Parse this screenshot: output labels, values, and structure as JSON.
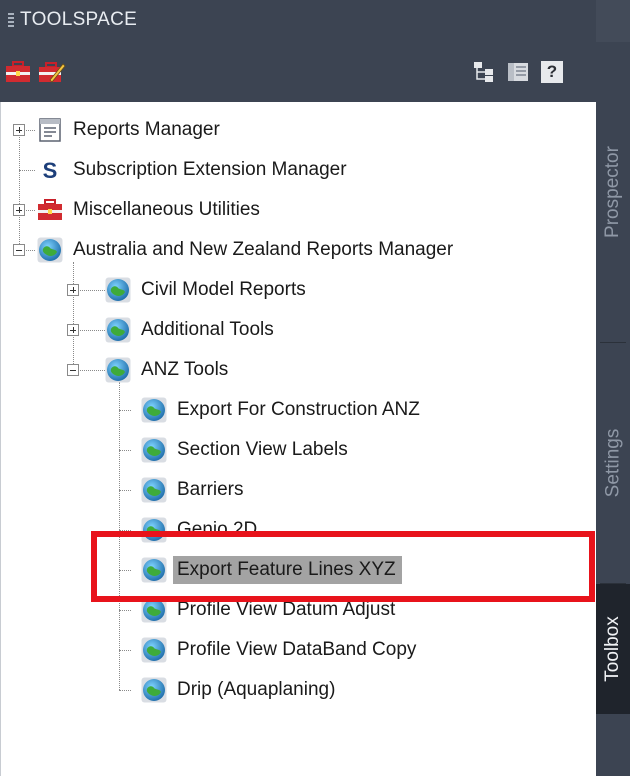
{
  "panel": {
    "title": "TOOLSPACE"
  },
  "toolbar": {
    "buttons": [
      {
        "name": "toolbox-icon"
      },
      {
        "name": "edit-toolbox-icon"
      },
      {
        "name": "tree-view-icon"
      },
      {
        "name": "list-view-icon"
      },
      {
        "name": "help-icon",
        "label": "?"
      }
    ]
  },
  "sidebar": {
    "tabs": [
      {
        "label": "Prospector",
        "active": false
      },
      {
        "label": "Settings",
        "active": false
      },
      {
        "label": "Toolbox",
        "active": true
      }
    ]
  },
  "tree": {
    "items": [
      {
        "label": "Reports Manager",
        "level": 0,
        "icon": "reports-manager-icon",
        "expander": "plus"
      },
      {
        "label": "Subscription Extension Manager",
        "level": 0,
        "icon": "subscription-s-icon",
        "expander": "none"
      },
      {
        "label": "Miscellaneous Utilities",
        "level": 0,
        "icon": "toolbox-icon",
        "expander": "plus"
      },
      {
        "label": "Australia and New Zealand Reports Manager",
        "level": 0,
        "icon": "globe-icon",
        "expander": "minus"
      },
      {
        "label": "Civil Model Reports",
        "level": 1,
        "icon": "globe-icon",
        "expander": "plus"
      },
      {
        "label": "Additional Tools",
        "level": 1,
        "icon": "globe-icon",
        "expander": "plus"
      },
      {
        "label": "ANZ Tools",
        "level": 1,
        "icon": "globe-icon",
        "expander": "minus"
      },
      {
        "label": "Export For Construction ANZ",
        "level": 2,
        "icon": "globe-icon",
        "expander": "none"
      },
      {
        "label": "Section View Labels",
        "level": 2,
        "icon": "globe-icon",
        "expander": "none"
      },
      {
        "label": "Barriers",
        "level": 2,
        "icon": "globe-icon",
        "expander": "none"
      },
      {
        "label": "Genio 2D",
        "level": 2,
        "icon": "globe-icon",
        "expander": "none"
      },
      {
        "label": "Export Feature Lines XYZ",
        "level": 2,
        "icon": "globe-icon",
        "expander": "none",
        "selected": true
      },
      {
        "label": "Profile View Datum Adjust",
        "level": 2,
        "icon": "globe-icon",
        "expander": "none"
      },
      {
        "label": "Profile View DataBand Copy",
        "level": 2,
        "icon": "globe-icon",
        "expander": "none"
      },
      {
        "label": "Drip (Aquaplaning)",
        "level": 2,
        "icon": "globe-icon",
        "expander": "none"
      }
    ]
  },
  "annotation": {
    "highlight_color": "#e8131b",
    "highlighted_item": "Export Feature Lines XYZ"
  }
}
